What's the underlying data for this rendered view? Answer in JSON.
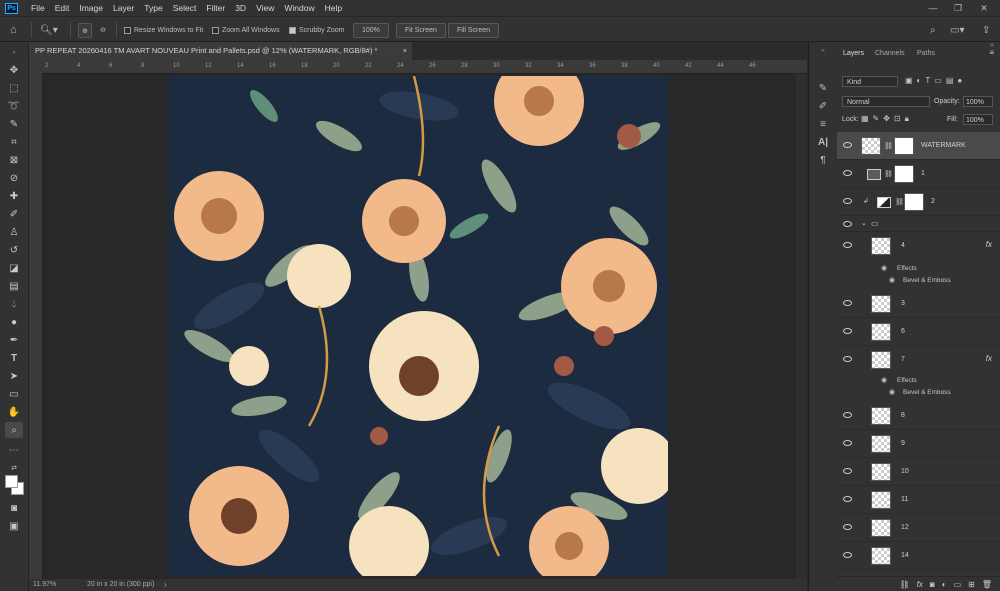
{
  "app": {
    "logo": "Ps"
  },
  "menu": [
    "File",
    "Edit",
    "Image",
    "Layer",
    "Type",
    "Select",
    "Filter",
    "3D",
    "View",
    "Window",
    "Help"
  ],
  "window_controls": [
    "minimize-icon",
    "restore-icon",
    "close-icon"
  ],
  "options": {
    "resize_windows": "Resize Windows to Fit",
    "zoom_all_windows": "Zoom All Windows",
    "scrubby_zoom": "Scrubby Zoom",
    "zoom_level": "100%",
    "fit_screen": "Fit Screen",
    "fill_screen": "Fill Screen"
  },
  "document": {
    "tab_title": "PP REPEAT 20260416 TM AVART NOUVEAU Print and Pallets.psd @ 12% (WATERMARK, RGB/8#) *",
    "status_zoom": "11.97%",
    "status_size": "20 in x 20 in (300 ppi)",
    "ruler_top": [
      "2",
      "4",
      "6",
      "8",
      "10",
      "12",
      "14",
      "16",
      "18",
      "20",
      "22",
      "24",
      "26",
      "28",
      "30",
      "32",
      "34",
      "36",
      "38",
      "40",
      "42",
      "44",
      "46"
    ],
    "artwork_colors": {
      "background": "#1c2b3f",
      "leaf": "#8ea08a",
      "peony": "#f2b98a",
      "cream": "#f6e2bf",
      "accent": "#a35a45"
    }
  },
  "layers_panel": {
    "tabs": [
      "Layers",
      "Channels",
      "Paths"
    ],
    "kind_label": "Kind",
    "blend_mode": "Normal",
    "opacity_label": "Opacity:",
    "opacity_value": "100%",
    "lock_label": "Lock:",
    "fill_label": "Fill:",
    "fill_value": "100%",
    "rows": [
      {
        "name": "WATERMARK",
        "selected": true
      },
      {
        "name": "1"
      },
      {
        "name": "2"
      },
      {
        "name": ""
      },
      {
        "name": "4",
        "fx": "fx"
      },
      {
        "name": "3"
      },
      {
        "name": "6"
      },
      {
        "name": "7",
        "fx": "fx"
      },
      {
        "name": "8"
      },
      {
        "name": "9"
      },
      {
        "name": "10"
      },
      {
        "name": "11"
      },
      {
        "name": "12"
      },
      {
        "name": "14"
      }
    ],
    "effects_label": "Effects",
    "effect_name": "Bevel & Emboss"
  }
}
